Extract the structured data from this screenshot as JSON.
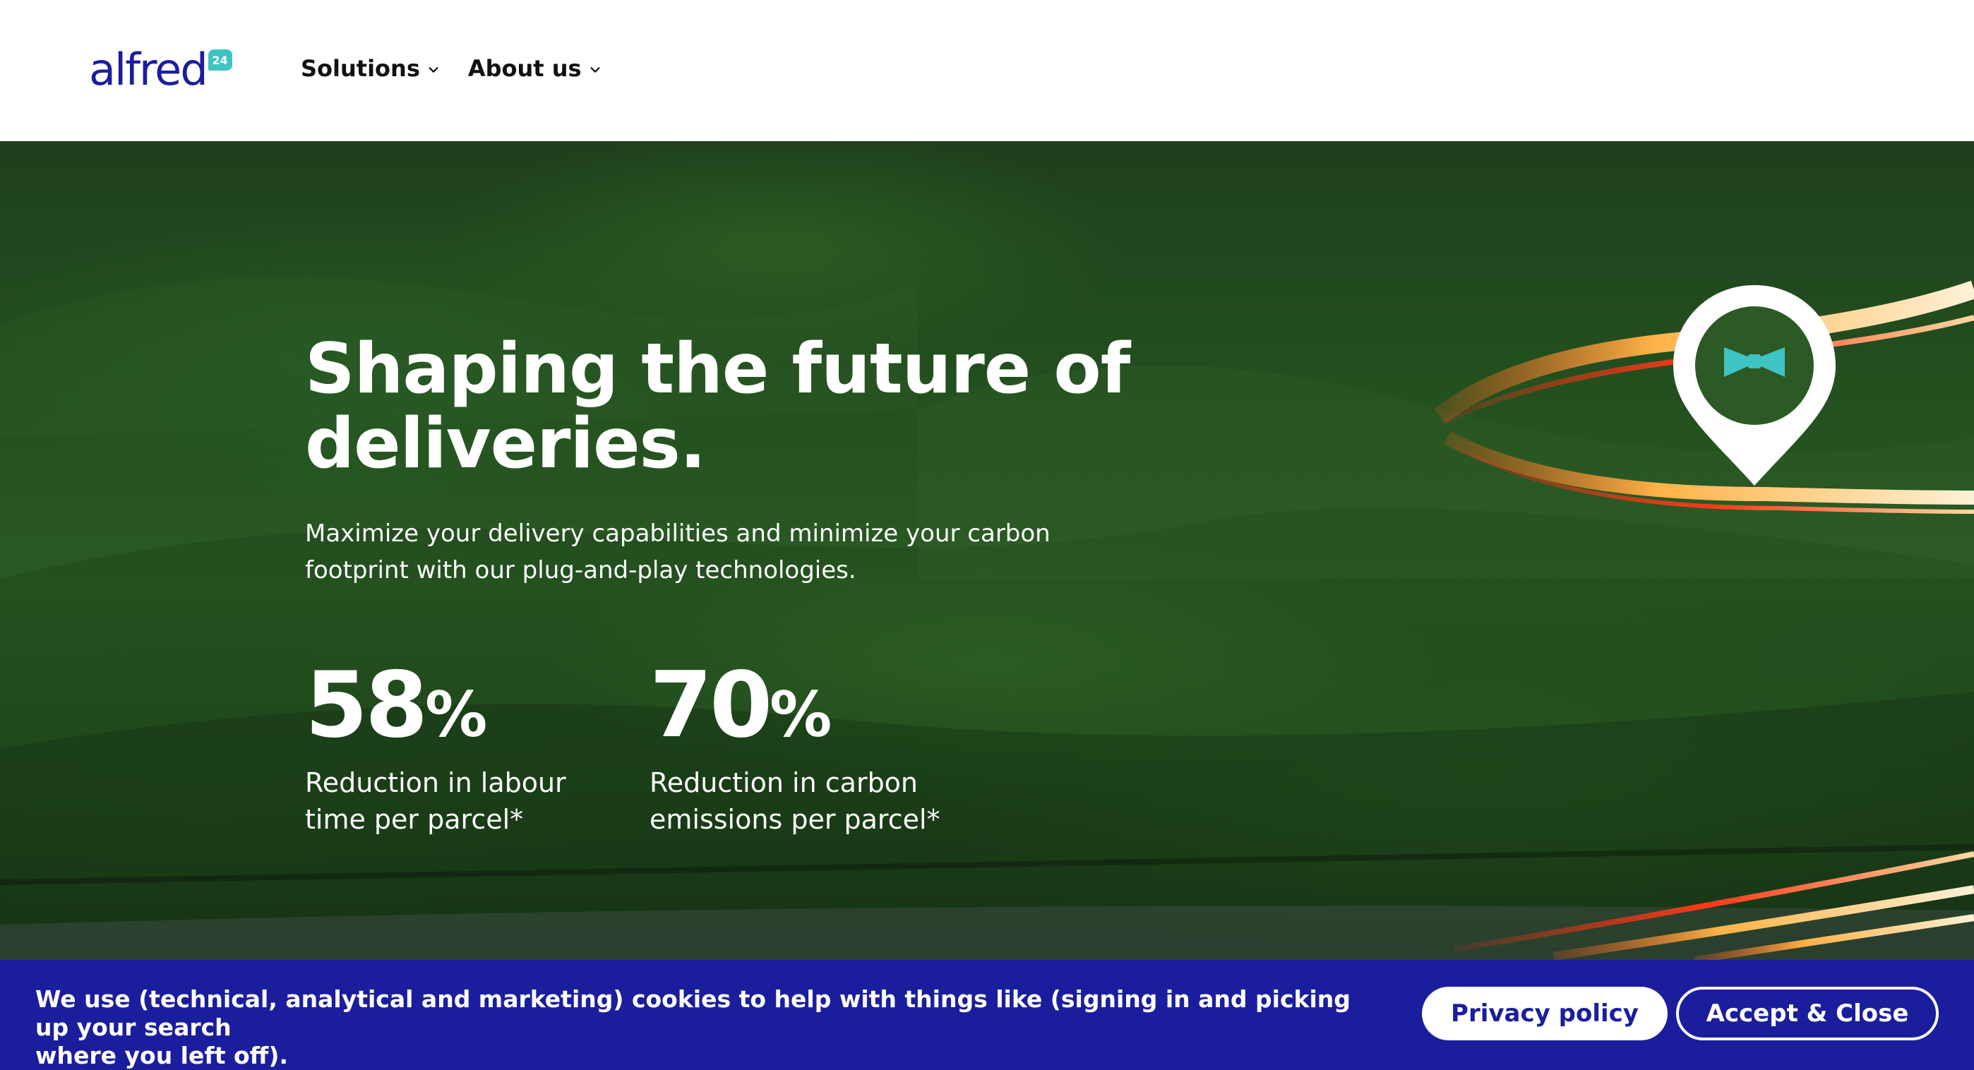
{
  "header": {
    "logo_text": "alfred",
    "logo_badge": "24",
    "nav": [
      {
        "label": "Solutions",
        "icon": "chevron-down-icon"
      },
      {
        "label": "About us",
        "icon": "chevron-down-icon"
      }
    ]
  },
  "hero": {
    "title_line1": "Shaping the future of",
    "title_line2": "deliveries.",
    "subtitle_line1": "Maximize your delivery capabilities and minimize your carbon",
    "subtitle_line2": "footprint with our plug-and-play technologies.",
    "stats": [
      {
        "value": "58",
        "unit": "%",
        "label_line1": "Reduction in labour",
        "label_line2": "time per parcel*"
      },
      {
        "value": "70",
        "unit": "%",
        "label_line1": "Reduction in carbon",
        "label_line2": "emissions per parcel*"
      }
    ],
    "map_pin_icon": "location-pin-bowtie-icon"
  },
  "cookie_banner": {
    "text_line1": "We use (technical, analytical and marketing) cookies to help with things like (signing in and picking up your search",
    "text_line2": "where you left off).",
    "privacy_label": "Privacy policy",
    "accept_label": "Accept & Close"
  },
  "colors": {
    "brand_navy": "#1b1e9c",
    "brand_teal": "#3ec4c3",
    "hero_green": "#2a5a24"
  }
}
